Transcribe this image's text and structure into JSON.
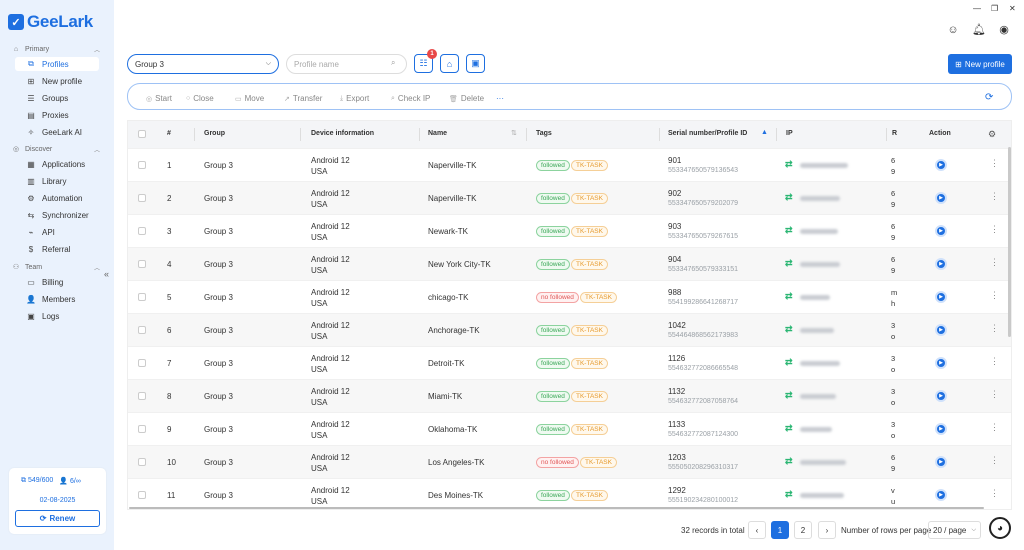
{
  "app": {
    "logo_text": "GeeLark"
  },
  "window": {
    "minimize": "—",
    "restore": "❐",
    "close": "✕"
  },
  "sidebar": {
    "primary_label": "Primary",
    "primary_items": [
      {
        "label": "Profiles",
        "icon": "profiles-icon",
        "glyph": "⧉",
        "active": true
      },
      {
        "label": "New profile",
        "icon": "new-profile-icon",
        "glyph": "⊞"
      },
      {
        "label": "Groups",
        "icon": "groups-icon",
        "glyph": "☰"
      },
      {
        "label": "Proxies",
        "icon": "proxies-icon",
        "glyph": "▤"
      },
      {
        "label": "GeeLark AI",
        "icon": "ai-icon",
        "glyph": "✧"
      }
    ],
    "discover_label": "Discover",
    "discover_items": [
      {
        "label": "Applications",
        "icon": "applications-icon",
        "glyph": "▦"
      },
      {
        "label": "Library",
        "icon": "library-icon",
        "glyph": "▥"
      },
      {
        "label": "Automation",
        "icon": "automation-icon",
        "glyph": "⚙"
      },
      {
        "label": "Synchronizer",
        "icon": "synchronizer-icon",
        "glyph": "⇆"
      },
      {
        "label": "API",
        "icon": "api-icon",
        "glyph": "⌁"
      },
      {
        "label": "Referral",
        "icon": "referral-icon",
        "glyph": "$"
      }
    ],
    "team_label": "Team",
    "team_items": [
      {
        "label": "Billing",
        "icon": "billing-icon",
        "glyph": "▭"
      },
      {
        "label": "Members",
        "icon": "members-icon",
        "glyph": "👤"
      },
      {
        "label": "Logs",
        "icon": "logs-icon",
        "glyph": "▣"
      }
    ],
    "quota": {
      "profiles": "549/600",
      "members": "6/∞",
      "date": "02-08-2025",
      "renew_label": "Renew"
    }
  },
  "toolbar": {
    "group_value": "Group 3",
    "name_placeholder": "Profile name",
    "filter_badge": "1",
    "new_profile_label": "New profile"
  },
  "actions": {
    "start": "Start",
    "close": "Close",
    "move": "Move",
    "transfer": "Transfer",
    "export": "Export",
    "check_ip": "Check IP",
    "delete": "Delete",
    "more": "···"
  },
  "table": {
    "headers": {
      "index": "#",
      "group": "Group",
      "device": "Device information",
      "name": "Name",
      "tags": "Tags",
      "serial": "Serial number/Profile ID",
      "ip": "IP",
      "r": "R",
      "action": "Action"
    },
    "rows": [
      {
        "index": "1",
        "group": "Group 3",
        "os": "Android 12",
        "country": "USA",
        "name": "Naperville-TK",
        "tag1": "followed",
        "tag1_type": "green",
        "tag2": "TK-TASK",
        "serial": "901",
        "profile_id": "553347650579136543",
        "r1": "6",
        "r2": "9"
      },
      {
        "index": "2",
        "group": "Group 3",
        "os": "Android 12",
        "country": "USA",
        "name": "Naperville-TK",
        "tag1": "followed",
        "tag1_type": "green",
        "tag2": "TK-TASK",
        "serial": "902",
        "profile_id": "553347650579202079",
        "r1": "6",
        "r2": "9"
      },
      {
        "index": "3",
        "group": "Group 3",
        "os": "Android 12",
        "country": "USA",
        "name": "Newark-TK",
        "tag1": "followed",
        "tag1_type": "green",
        "tag2": "TK-TASK",
        "serial": "903",
        "profile_id": "553347650579267615",
        "r1": "6",
        "r2": "9"
      },
      {
        "index": "4",
        "group": "Group 3",
        "os": "Android 12",
        "country": "USA",
        "name": "New York City-TK",
        "tag1": "followed",
        "tag1_type": "green",
        "tag2": "TK-TASK",
        "serial": "904",
        "profile_id": "553347650579333151",
        "r1": "6",
        "r2": "9"
      },
      {
        "index": "5",
        "group": "Group 3",
        "os": "Android 12",
        "country": "USA",
        "name": "chicago-TK",
        "tag1": "no followed",
        "tag1_type": "red",
        "tag2": "TK-TASK",
        "serial": "988",
        "profile_id": "554199286641268717",
        "r1": "m",
        "r2": "h"
      },
      {
        "index": "6",
        "group": "Group 3",
        "os": "Android 12",
        "country": "USA",
        "name": "Anchorage-TK",
        "tag1": "followed",
        "tag1_type": "green",
        "tag2": "TK-TASK",
        "serial": "1042",
        "profile_id": "554464868562173983",
        "r1": "3",
        "r2": "o"
      },
      {
        "index": "7",
        "group": "Group 3",
        "os": "Android 12",
        "country": "USA",
        "name": "Detroit-TK",
        "tag1": "followed",
        "tag1_type": "green",
        "tag2": "TK-TASK",
        "serial": "1126",
        "profile_id": "554632772086665548",
        "r1": "3",
        "r2": "o"
      },
      {
        "index": "8",
        "group": "Group 3",
        "os": "Android 12",
        "country": "USA",
        "name": "Miami-TK",
        "tag1": "followed",
        "tag1_type": "green",
        "tag2": "TK-TASK",
        "serial": "1132",
        "profile_id": "554632772087058764",
        "r1": "3",
        "r2": "o"
      },
      {
        "index": "9",
        "group": "Group 3",
        "os": "Android 12",
        "country": "USA",
        "name": "Oklahoma-TK",
        "tag1": "followed",
        "tag1_type": "green",
        "tag2": "TK-TASK",
        "serial": "1133",
        "profile_id": "554632772087124300",
        "r1": "3",
        "r2": "o"
      },
      {
        "index": "10",
        "group": "Group 3",
        "os": "Android 12",
        "country": "USA",
        "name": "Los Angeles-TK",
        "tag1": "no followed",
        "tag1_type": "red",
        "tag2": "TK-TASK",
        "serial": "1203",
        "profile_id": "555050208296310317",
        "r1": "6",
        "r2": "9"
      },
      {
        "index": "11",
        "group": "Group 3",
        "os": "Android 12",
        "country": "USA",
        "name": "Des Moines-TK",
        "tag1": "followed",
        "tag1_type": "green",
        "tag2": "TK-TASK",
        "serial": "1292",
        "profile_id": "555190234280100012",
        "r1": "v",
        "r2": "u"
      }
    ]
  },
  "pagination": {
    "total": "32 records in total",
    "prev": "‹",
    "next": "›",
    "pages": [
      "1",
      "2"
    ],
    "rows_label": "Number of rows per page",
    "rows_value": "20 / page"
  },
  "colors": {
    "accent": "#1e6fe0",
    "followed": "#3aa757",
    "no_followed": "#e05757",
    "task": "#e69a2e"
  }
}
